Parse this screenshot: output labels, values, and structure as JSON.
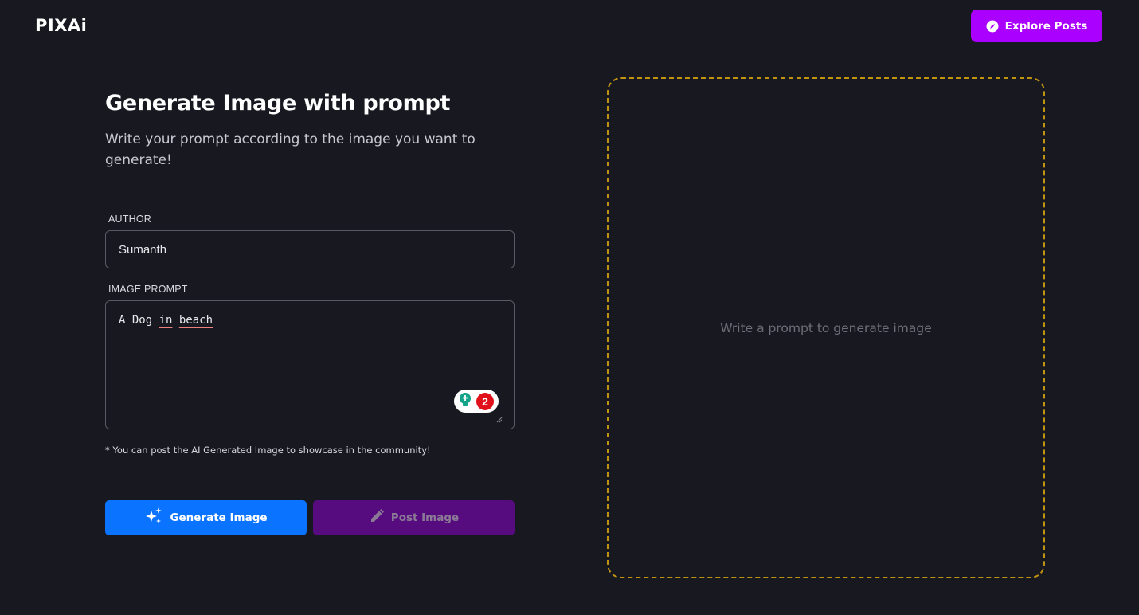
{
  "header": {
    "logo": "PIXAi",
    "explore_label": "Explore Posts",
    "explore_icon": "compass-icon",
    "accent_color": "#aa00ff"
  },
  "form": {
    "title": "Generate Image with prompt",
    "subtitle": "Write your prompt according to the image you want to generate!",
    "author": {
      "label": "AUTHOR",
      "value": "Sumanth"
    },
    "prompt": {
      "label": "IMAGE PROMPT",
      "value_plain": "A Dog ",
      "value_word1": "in",
      "value_space": " ",
      "value_word2": "beach",
      "grammar_count": "2"
    },
    "note": "* You can post the AI Generated Image to showcase in the community!",
    "generate_label": "Generate Image",
    "generate_icon": "sparkles-icon",
    "generate_color": "#0a73ff",
    "post_label": "Post Image",
    "post_icon": "pencil-icon",
    "post_color": "#560c7f"
  },
  "preview": {
    "placeholder": "Write a prompt to generate image",
    "border_color": "#c09410"
  }
}
